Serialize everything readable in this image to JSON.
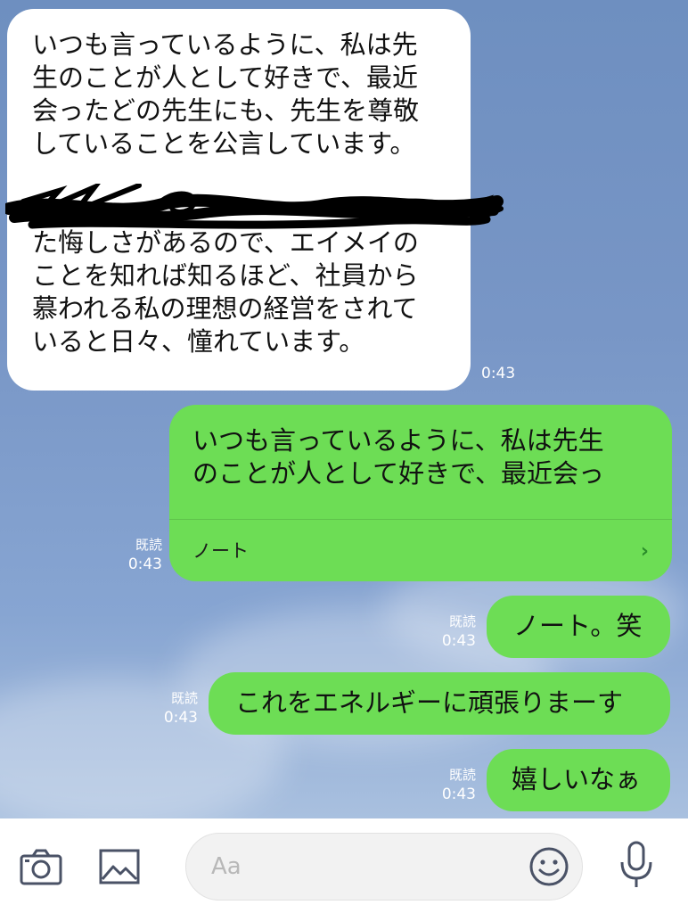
{
  "colors": {
    "chat_background": "#7896c6",
    "incoming_bubble": "#ffffff",
    "outgoing_bubble": "#6ddd55",
    "meta_text": "#ffffff",
    "icon": "#4a5266"
  },
  "messages": [
    {
      "direction": "incoming",
      "lines": [
        "いつも言っているように、私は先",
        "生のことが人として好きで、最近",
        "会ったどの先生にも、先生を尊敬",
        "していることを公言しています。"
      ],
      "redacted_line": true,
      "lines_after": [
        "た悔しさがあるので、エイメイの",
        "ことを知れば知るほど、社員から",
        "慕われる私の理想の経営をされて",
        "いると日々、憧れています。"
      ],
      "time": "0:43"
    },
    {
      "direction": "outgoing",
      "type": "note",
      "lines": [
        "いつも言っているように、私は先生",
        "のことが人として好きで、最近会っ"
      ],
      "note_label": "ノート",
      "note_icon": "chevron-right-icon",
      "read": "既読",
      "time": "0:43"
    },
    {
      "direction": "outgoing",
      "text": "ノート。笑",
      "read": "既読",
      "time": "0:43"
    },
    {
      "direction": "outgoing",
      "text": "これをエネルギーに頑張りまーす",
      "read": "既読",
      "time": "0:43"
    },
    {
      "direction": "outgoing",
      "text": "嬉しいなぁ",
      "read": "既読",
      "time": "0:43"
    }
  ],
  "input_bar": {
    "camera_icon": "camera-icon",
    "image_icon": "image-icon",
    "placeholder": "Aa",
    "emoji_icon": "emoji-icon",
    "mic_icon": "microphone-icon"
  }
}
